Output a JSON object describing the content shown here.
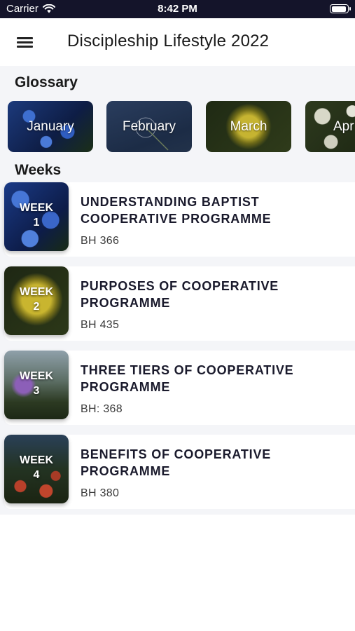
{
  "status_bar": {
    "carrier": "Carrier",
    "time": "8:42 PM"
  },
  "header": {
    "title": "Discipleship Lifestyle 2022"
  },
  "glossary": {
    "title": "Glossary",
    "months": [
      {
        "label": "January"
      },
      {
        "label": "February"
      },
      {
        "label": "March"
      },
      {
        "label": "Apr"
      }
    ]
  },
  "weeks": {
    "title": "Weeks",
    "items": [
      {
        "badge_word": "WEEK",
        "badge_number": "1",
        "title": "UNDERSTANDING BAPTIST COOPERATIVE PROGRAMME",
        "hymn": "BH 366"
      },
      {
        "badge_word": "WEEK",
        "badge_number": "2",
        "title": "PURPOSES OF COOPERATIVE PROGRAMME",
        "hymn": "BH 435"
      },
      {
        "badge_word": "WEEK",
        "badge_number": "3",
        "title": "THREE TIERS OF COOPERATIVE PROGRAMME",
        "hymn": "BH: 368"
      },
      {
        "badge_word": "WEEK",
        "badge_number": "4",
        "title": "BENEFITS OF COOPERATIVE PROGRAMME",
        "hymn": "BH 380"
      }
    ]
  }
}
